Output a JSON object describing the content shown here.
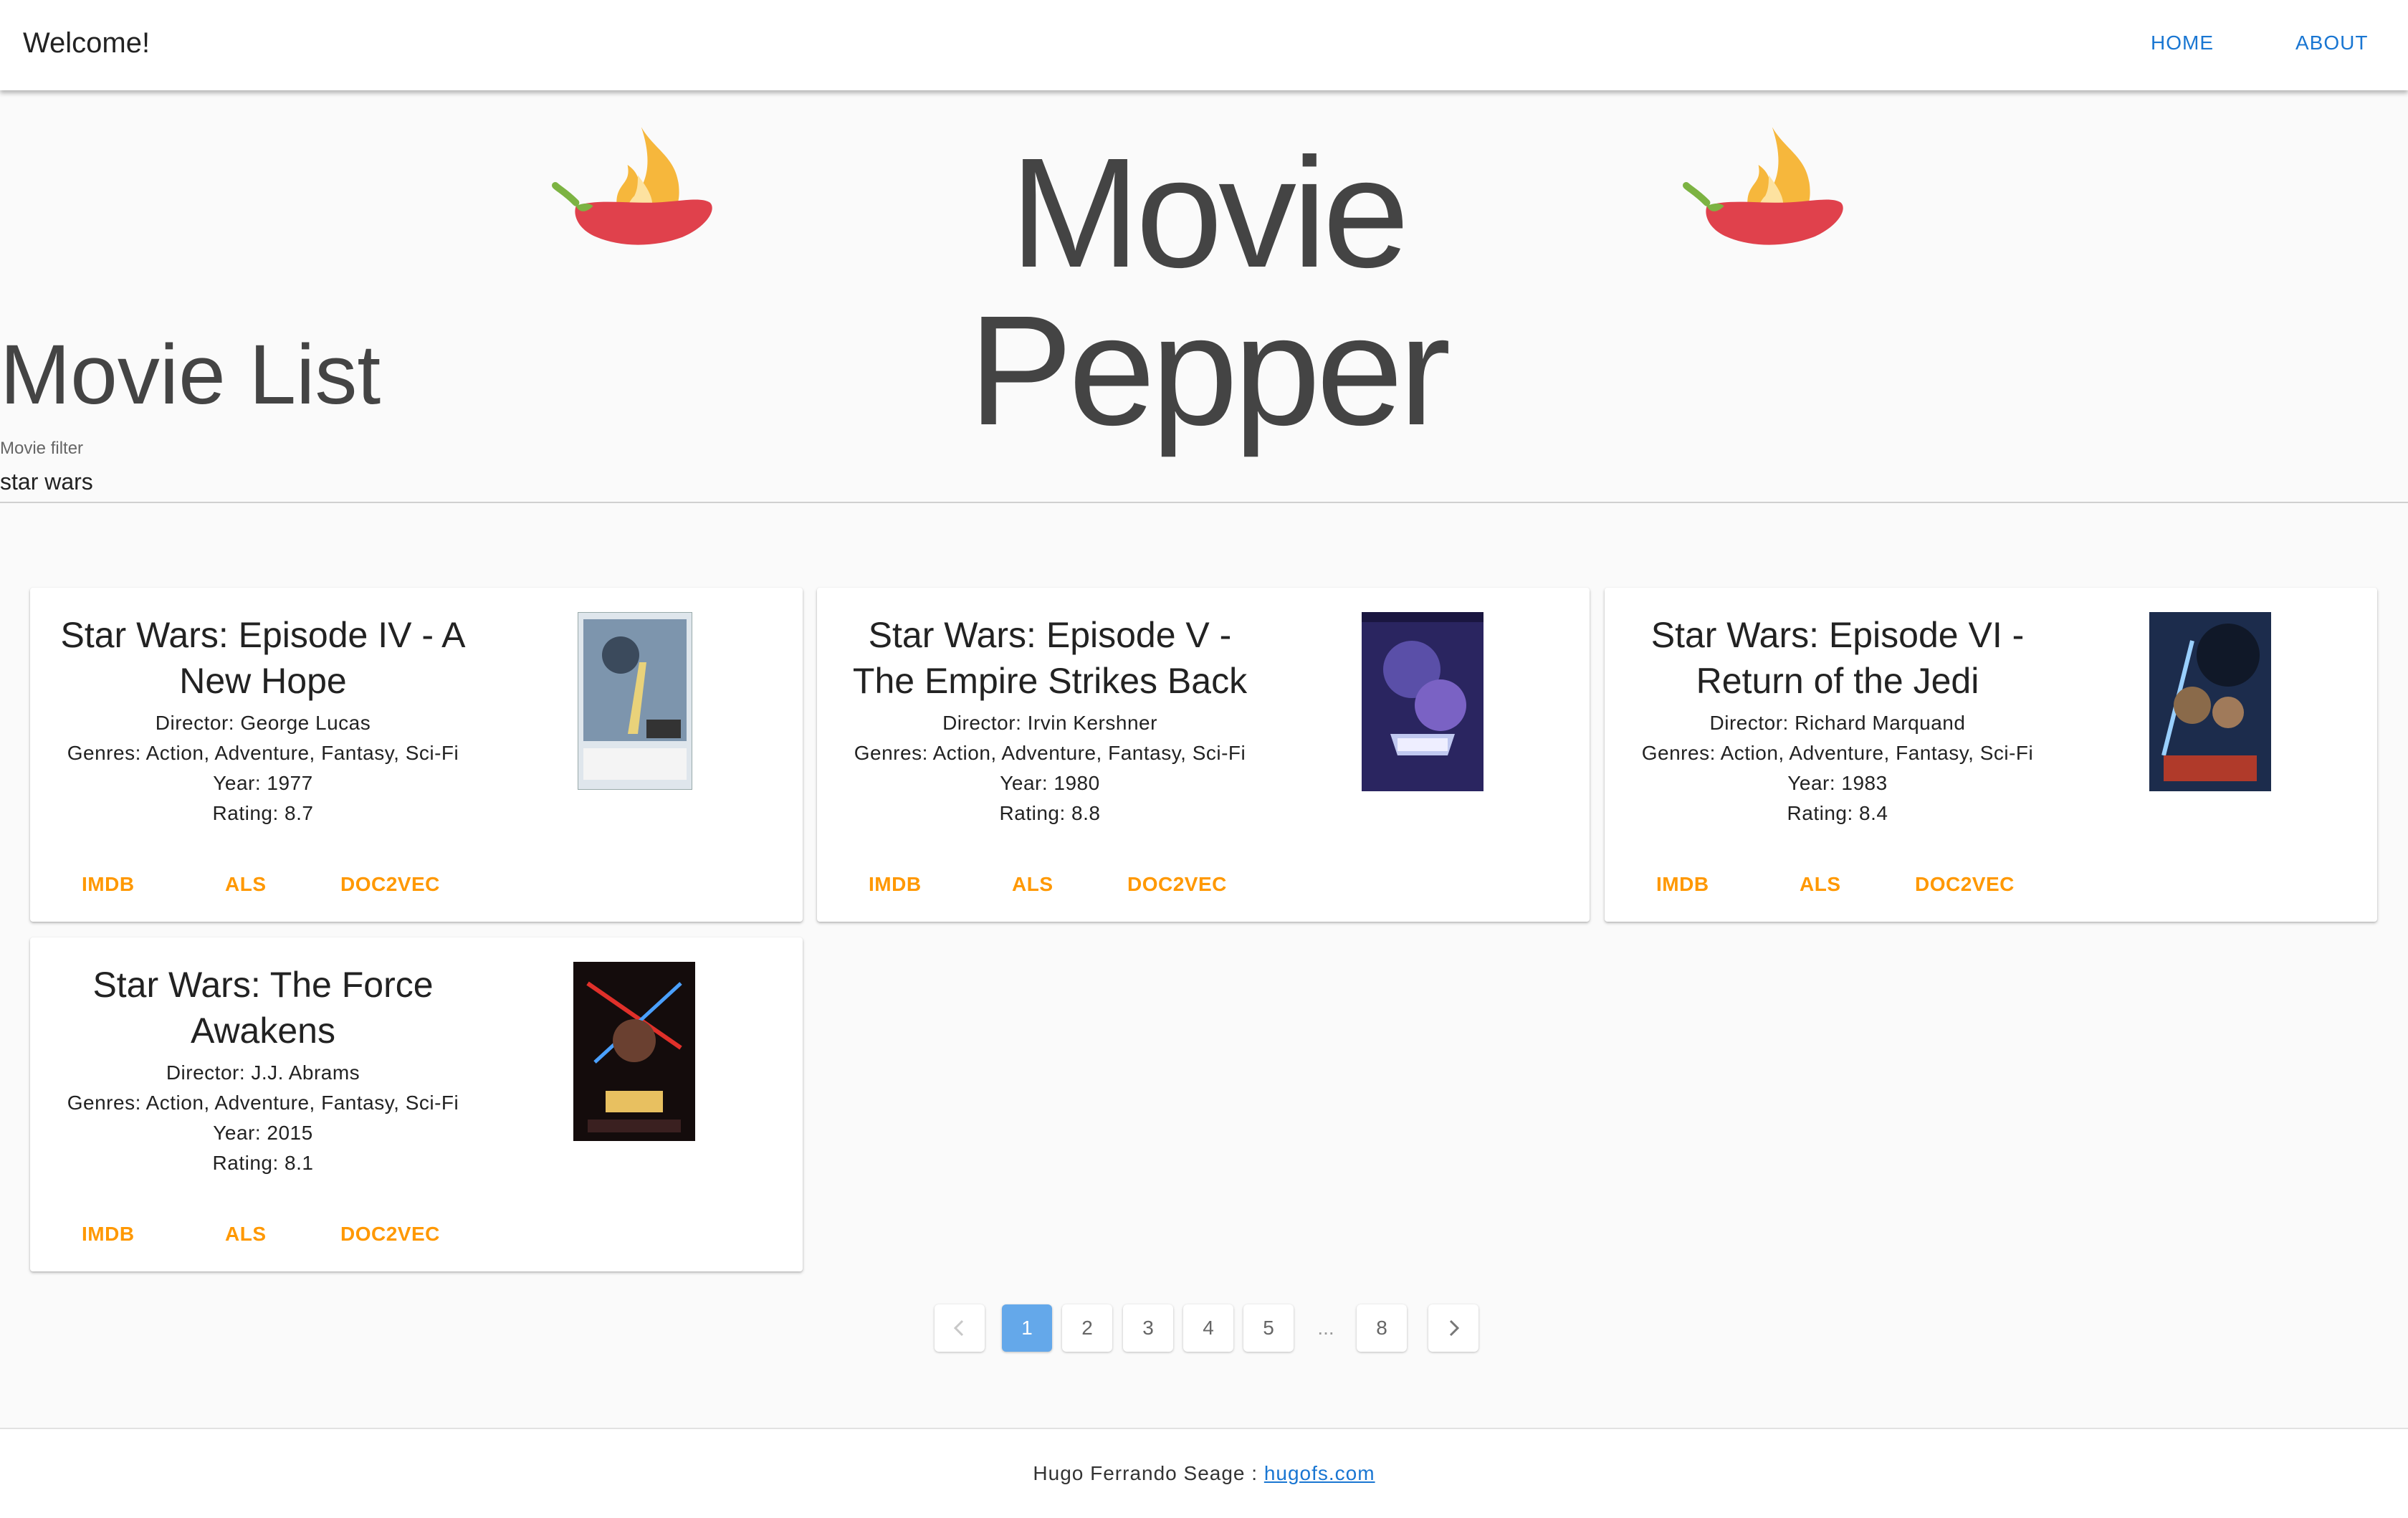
{
  "appbar": {
    "title": "Welcome!",
    "nav": [
      "HOME",
      "ABOUT"
    ]
  },
  "hero": {
    "brand": "Movie Pepper"
  },
  "section": {
    "title": "Movie List"
  },
  "filter": {
    "label": "Movie filter",
    "value": "star wars"
  },
  "movies": [
    {
      "title": "Star Wars: Episode IV - A New Hope",
      "director": "Director: George Lucas",
      "genres": "Genres: Action, Adventure, Fantasy, Sci-Fi",
      "year": "Year: 1977",
      "rating": "Rating: 8.7",
      "buttons": [
        "IMDB",
        "ALS",
        "DOC2VEC"
      ]
    },
    {
      "title": "Star Wars: Episode V - The Empire Strikes Back",
      "director": "Director: Irvin Kershner",
      "genres": "Genres: Action, Adventure, Fantasy, Sci-Fi",
      "year": "Year: 1980",
      "rating": "Rating: 8.8",
      "buttons": [
        "IMDB",
        "ALS",
        "DOC2VEC"
      ]
    },
    {
      "title": "Star Wars: Episode VI - Return of the Jedi",
      "director": "Director: Richard Marquand",
      "genres": "Genres: Action, Adventure, Fantasy, Sci-Fi",
      "year": "Year: 1983",
      "rating": "Rating: 8.4",
      "buttons": [
        "IMDB",
        "ALS",
        "DOC2VEC"
      ]
    },
    {
      "title": "Star Wars: The Force Awakens",
      "director": "Director: J.J. Abrams",
      "genres": "Genres: Action, Adventure, Fantasy, Sci-Fi",
      "year": "Year: 2015",
      "rating": "Rating: 8.1",
      "buttons": [
        "IMDB",
        "ALS",
        "DOC2VEC"
      ]
    }
  ],
  "pagination": {
    "pages": [
      "1",
      "2",
      "3",
      "4",
      "5",
      "...",
      "8"
    ],
    "current": "1"
  },
  "footer": {
    "author": "Hugo Ferrando Seage : ",
    "link": "hugofs.com"
  },
  "colors": {
    "accent": "#ff9800",
    "link": "#1976d2",
    "active_page": "#64a8ea"
  },
  "icons": {
    "brand": "hot-pepper-icon",
    "prev": "chevron-left-icon",
    "next": "chevron-right-icon"
  }
}
